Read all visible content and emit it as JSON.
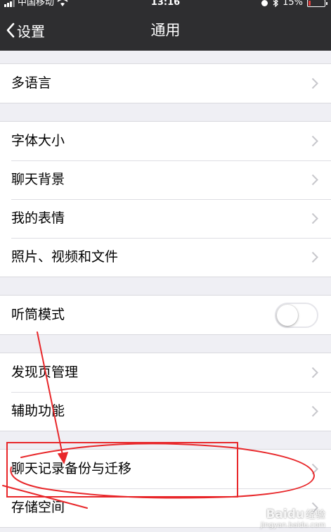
{
  "status_bar": {
    "carrier": "中国移动",
    "time": "13:16",
    "battery": "15%",
    "battery_level": 0.15
  },
  "nav": {
    "back_label": "设置",
    "title": "通用"
  },
  "groups": [
    {
      "items": [
        {
          "label": "多语言"
        }
      ]
    },
    {
      "items": [
        {
          "label": "字体大小"
        },
        {
          "label": "聊天背景"
        },
        {
          "label": "我的表情"
        },
        {
          "label": "照片、视频和文件"
        }
      ]
    },
    {
      "items": [
        {
          "label": "听筒模式",
          "toggle": false
        }
      ]
    },
    {
      "items": [
        {
          "label": "发现页管理"
        },
        {
          "label": "辅助功能"
        }
      ]
    },
    {
      "items": [
        {
          "label": "聊天记录备份与迁移"
        },
        {
          "label": "存储空间"
        }
      ]
    }
  ],
  "annotation_color": "#e8272a",
  "watermark": {
    "brand": "Baidu",
    "sub": "经验",
    "url": "jingyan.baidu.com"
  }
}
